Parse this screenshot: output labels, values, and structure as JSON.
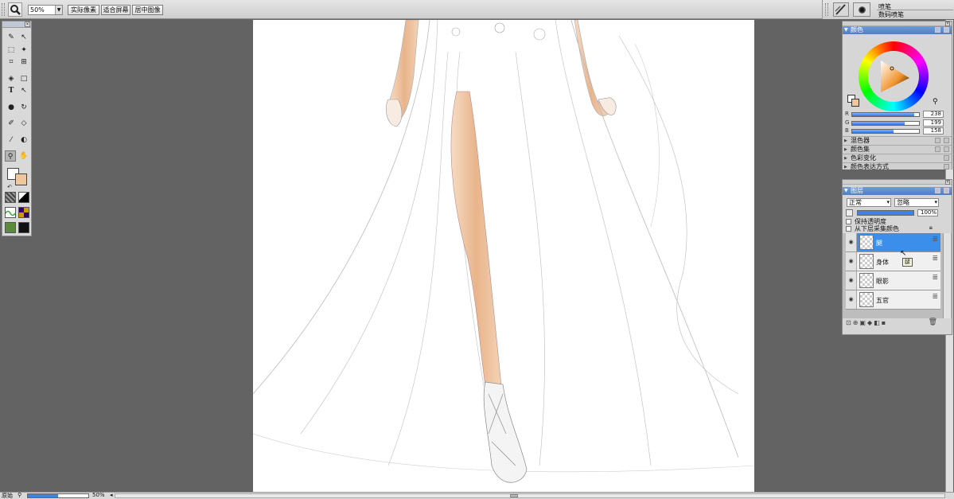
{
  "topbar": {
    "tool_icon": "zoom-magnifier-icon",
    "zoom_value": "50%",
    "buttons": [
      "实际像素",
      "适合屏幕",
      "居中图像"
    ]
  },
  "brush": {
    "name": "喷笔",
    "variant": "数码喷笔"
  },
  "toolbox": {
    "icons": [
      "brush-icon",
      "layer-adjuster-icon",
      "rect-select-icon",
      "magic-wand-icon",
      "crop-icon",
      "transform-icon",
      "paint-bucket-icon",
      "rectangle-shape-icon",
      "text-icon",
      "pen-select-icon",
      "dropper-icon",
      "rotate-page-icon",
      "clone-icon",
      "eraser-icon",
      "eyedropper-icon",
      "burn-icon",
      "magnifier-icon",
      "grabber-icon"
    ],
    "main_color": "#ffffff",
    "additional_color": "#eec79e"
  },
  "color_panel": {
    "title": "颜色",
    "r_label": "R",
    "g_label": "G",
    "b_label": "B",
    "r": "238",
    "g": "199",
    "b": "158",
    "r_level": 0.93,
    "g_level": 0.78,
    "b_level": 0.62,
    "color": "#eec79e",
    "subpanels": [
      "混色器",
      "颜色集",
      "色彩变化",
      "颜色表达方式"
    ]
  },
  "layers_panel": {
    "title": "图层",
    "composite_method": "正常",
    "composite_depth": "忽略",
    "opacity": "100%",
    "preserve_transparency": "保持透明度",
    "pick_up_underlying": "从下层采集颜色",
    "layers": [
      {
        "name": "腿",
        "selected": true
      },
      {
        "name": "身体",
        "selected": false
      },
      {
        "name": "眼影",
        "selected": false
      },
      {
        "name": "五官",
        "selected": false
      }
    ],
    "tooltip": "腿"
  },
  "statusbar": {
    "zoom": "50%",
    "mode_label": "原始"
  }
}
